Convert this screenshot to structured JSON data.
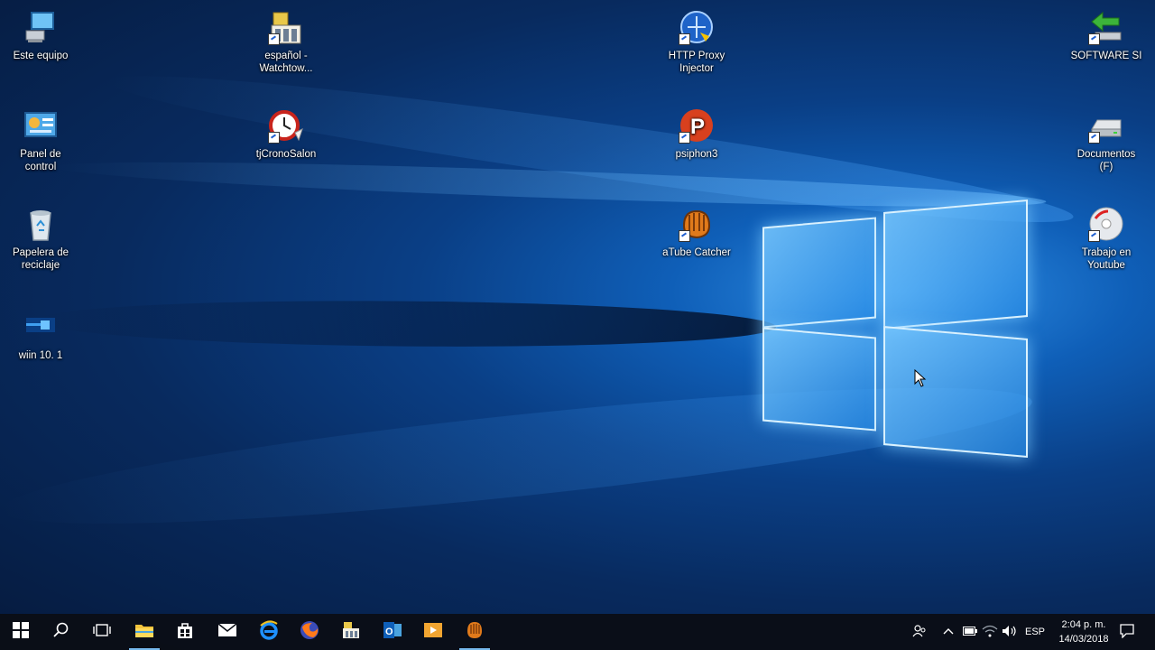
{
  "desktop": {
    "icons": [
      {
        "label": "Este equipo",
        "icon": "computer-icon"
      },
      {
        "label": "Panel de control",
        "icon": "control-panel-icon"
      },
      {
        "label": "Papelera de reciclaje",
        "icon": "recycle-bin-icon"
      },
      {
        "label": "wiin 10. 1",
        "icon": "windows-image-icon"
      },
      {
        "label": "español - Watchtow...",
        "icon": "watchtower-library-icon"
      },
      {
        "label": "tjCronoSalon",
        "icon": "alarm-clock-icon"
      },
      {
        "label": "HTTP Proxy Injector",
        "icon": "http-proxy-injector-icon"
      },
      {
        "label": "psiphon3",
        "icon": "psiphon-icon"
      },
      {
        "label": "aTube Catcher",
        "icon": "atube-catcher-icon"
      },
      {
        "label": "SOFTWARE SI",
        "icon": "green-arrow-icon"
      },
      {
        "label": "Documentos (F)",
        "icon": "drive-icon"
      },
      {
        "label": "Trabajo en Youtube",
        "icon": "disc-icon"
      }
    ]
  },
  "taskbar": {
    "pinned": [
      {
        "name": "start-button",
        "icon": "windows-logo-icon"
      },
      {
        "name": "search-button",
        "icon": "search-icon"
      },
      {
        "name": "task-view-button",
        "icon": "task-view-icon"
      },
      {
        "name": "file-explorer-button",
        "icon": "folder-icon"
      },
      {
        "name": "store-button",
        "icon": "store-bag-icon"
      },
      {
        "name": "mail-button",
        "icon": "mail-icon"
      },
      {
        "name": "edge-button",
        "icon": "internet-explorer-icon"
      },
      {
        "name": "firefox-button",
        "icon": "firefox-icon"
      },
      {
        "name": "watchtower-button",
        "icon": "watchtower-library-icon"
      },
      {
        "name": "outlook-button",
        "icon": "outlook-icon"
      },
      {
        "name": "media-player-button",
        "icon": "media-player-icon"
      },
      {
        "name": "atube-button",
        "icon": "atube-catcher-icon"
      }
    ],
    "tray": {
      "language": "ESP",
      "time": "2:04 p. m.",
      "date": "14/03/2018"
    }
  },
  "colors": {
    "accent": "#76b9ed",
    "taskbar": "#0a0e16"
  }
}
